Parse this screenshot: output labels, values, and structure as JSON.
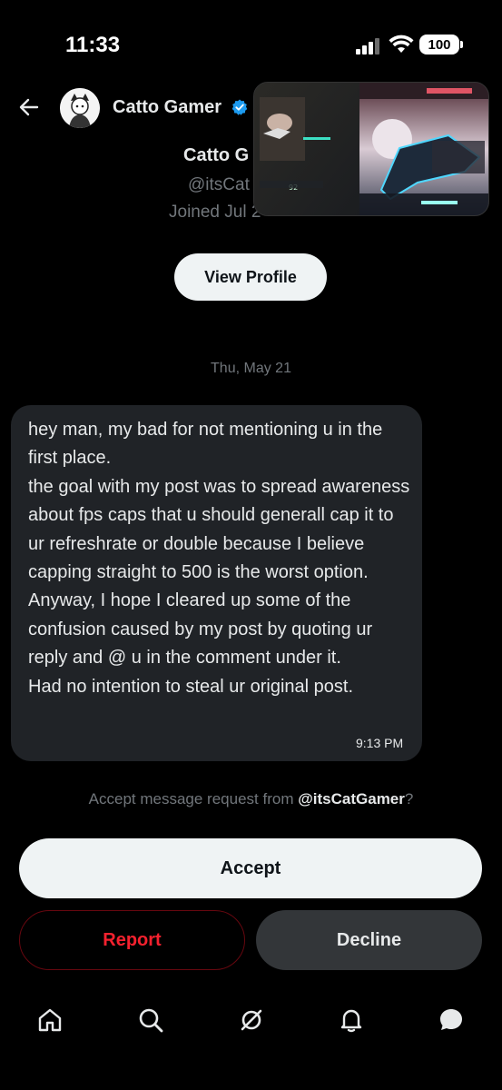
{
  "status_bar": {
    "time": "11:33",
    "battery": "100",
    "icons": [
      "signal-icon",
      "wifi-icon",
      "battery-icon"
    ]
  },
  "header": {
    "name": "Catto Gamer",
    "verified_color": "#1d9bf0",
    "icons": [
      "back-arrow-icon",
      "avatar",
      "verified-badge-icon"
    ]
  },
  "profile": {
    "name": "Catto G",
    "handle": "@itsCat",
    "joined": "Joined Jul 2",
    "view_profile_label": "View Profile"
  },
  "conversation": {
    "date": "Thu, May 21",
    "message": {
      "text": "hey man, my bad for not mentioning u in the first place.\nthe goal with my post was to spread awareness about fps caps that u should generall cap it to ur refreshrate or double because I believe capping straight to 500 is the worst option.\nAnyway, I hope I cleared up some of the confusion caused by my post by quoting ur reply and @ u in the comment under it.\nHad no intention to steal ur original post.",
      "time": "9:13 PM"
    }
  },
  "request": {
    "prefix": "Accept message request from ",
    "handle": "@itsCatGamer",
    "suffix": "?",
    "accept_label": "Accept",
    "report_label": "Report",
    "decline_label": "Decline"
  },
  "pip_video": {
    "hud_value": "92"
  },
  "bottom_nav": [
    "home-icon",
    "search-icon",
    "grok-icon",
    "notifications-icon",
    "messages-icon"
  ],
  "colors": {
    "background": "#000000",
    "bubble": "#202327",
    "report": "#f4212e",
    "muted": "#71767b"
  }
}
